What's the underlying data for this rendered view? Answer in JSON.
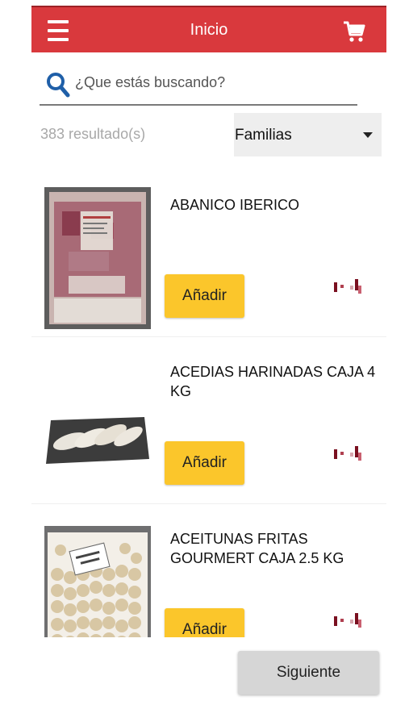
{
  "header": {
    "title": "Inicio",
    "menu_icon": "menu-icon",
    "cart_icon": "cart-icon"
  },
  "search": {
    "placeholder": "¿Que estás buscando?",
    "value": "",
    "icon": "search-icon"
  },
  "results": {
    "count_text": "383 resultado(s)"
  },
  "filter": {
    "selected": "Familias"
  },
  "products": [
    {
      "name": "ABANICO IBERICO",
      "add_label": "Añadir"
    },
    {
      "name": "ACEDIAS HARINADAS CAJA 4 KG",
      "add_label": "Añadir"
    },
    {
      "name": "ACEITUNAS FRITAS GOURMERT CAJA 2.5 KG",
      "add_label": "Añadir"
    }
  ],
  "pagination": {
    "next_label": "Siguiente"
  },
  "colors": {
    "header": "#d9393d",
    "add_button": "#fbc62b",
    "next_button": "#d6d6d6"
  }
}
